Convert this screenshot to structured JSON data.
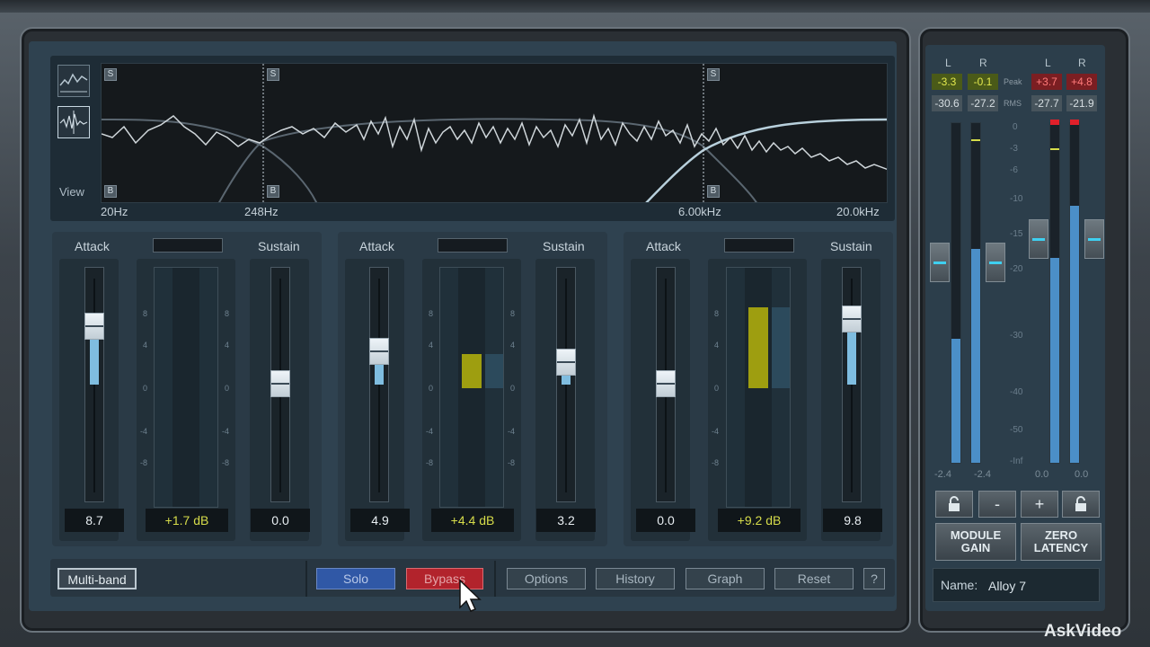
{
  "spectrum": {
    "view_label": "View",
    "freq_labels": [
      "20Hz",
      "248Hz",
      "6.00kHz",
      "20.0kHz"
    ],
    "solo_marker": "S",
    "bypass_marker": "B"
  },
  "bands": [
    {
      "attack_label": "Attack",
      "sustain_label": "Sustain",
      "attack_value": "8.7",
      "gain_value": "+1.7 dB",
      "sustain_value": "0.0"
    },
    {
      "attack_label": "Attack",
      "sustain_label": "Sustain",
      "attack_value": "4.9",
      "gain_value": "+4.4 dB",
      "sustain_value": "3.2"
    },
    {
      "attack_label": "Attack",
      "sustain_label": "Sustain",
      "attack_value": "0.0",
      "gain_value": "+9.2 dB",
      "sustain_value": "9.8"
    }
  ],
  "scale": [
    "8",
    "4",
    "0",
    "-4",
    "-8"
  ],
  "bottom": {
    "multiband": "Multi-band",
    "solo": "Solo",
    "bypass": "Bypass",
    "options": "Options",
    "history": "History",
    "graph": "Graph",
    "reset": "Reset",
    "help": "?"
  },
  "meters": {
    "left_label_l": "L",
    "left_label_r": "R",
    "right_label_l": "L",
    "right_label_r": "R",
    "peak_tag": "Peak",
    "rms_tag": "RMS",
    "in_peak_l": "-3.3",
    "in_peak_r": "-0.1",
    "in_rms_l": "-30.6",
    "in_rms_r": "-27.2",
    "out_peak_l": "+3.7",
    "out_peak_r": "+4.8",
    "out_rms_l": "-27.7",
    "out_rms_r": "-21.9",
    "scale": [
      "0",
      "-3",
      "-6",
      "-10",
      "-15",
      "-20",
      "-30",
      "-40",
      "-50",
      "-Inf"
    ],
    "in_bottom_l": "-2.4",
    "in_bottom_r": "-2.4",
    "out_bottom_l": "0.0",
    "out_bottom_r": "0.0",
    "minus": "-",
    "plus": "+",
    "module_gain_1": "MODULE",
    "module_gain_2": "GAIN",
    "zero_latency_1": "ZERO",
    "zero_latency_2": "LATENCY",
    "name_label": "Name:",
    "name_value": "Alloy 7"
  },
  "watermark": "AskVideo"
}
